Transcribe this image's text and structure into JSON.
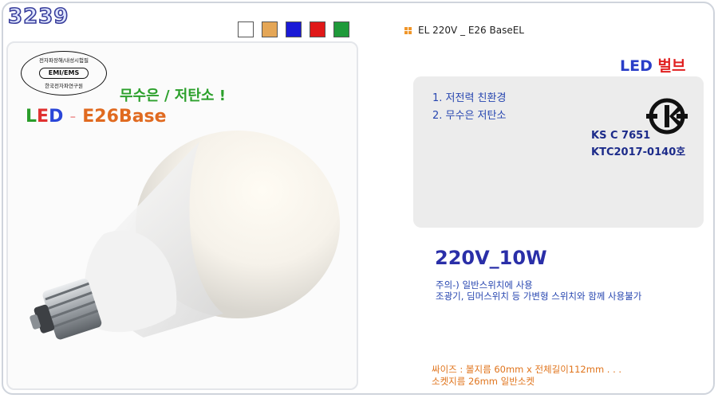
{
  "product_code": "3239",
  "swatches": [
    {
      "name": "white",
      "color": "#ffffff"
    },
    {
      "name": "tan",
      "color": "#e4a656"
    },
    {
      "name": "blue",
      "color": "#1a1ad6"
    },
    {
      "name": "red",
      "color": "#e01818"
    },
    {
      "name": "green",
      "color": "#1f9a3a"
    }
  ],
  "header": {
    "title": "EL 220V _ E26 BaseEL"
  },
  "photo": {
    "cert_top": "전자파장해/내성시험필",
    "cert_mid": "EMI/EMS",
    "cert_bottom": "한국전자파연구원",
    "slogan": "무수은 / 저탄소 !",
    "led_l": "L",
    "led_e": "E",
    "led_d": "D",
    "led_dash": "-",
    "led_base": "E26Base"
  },
  "product_type": {
    "a": "LED",
    "b": "벌브"
  },
  "features": [
    "1. 저전력 친환경",
    "2. 무수은 저탄소"
  ],
  "ks": {
    "line1": "KS C 7651",
    "line2": "KTC2017-0140호"
  },
  "spec": "220V_10W",
  "notes": [
    "주의-) 일반스위치에 사용",
    "조광기, 딤머스위치 등 가변형 스위치와 함께 사용불가"
  ],
  "size": [
    "싸이즈 : 볼지름 60mm x 전체길이112mm . . .",
    "소켓지름 26mm 일반소켓"
  ],
  "colors": {
    "accent_blue": "#2a2fa8",
    "accent_orange": "#e0741c",
    "accent_green": "#2ca02c"
  }
}
